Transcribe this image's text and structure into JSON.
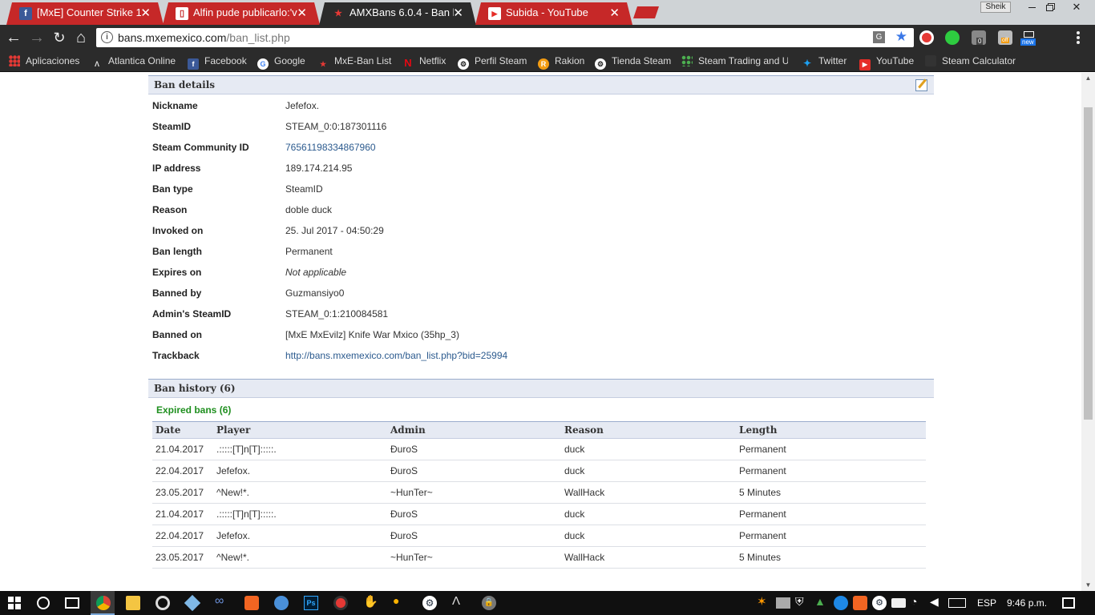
{
  "browser": {
    "tabs": [
      {
        "title": "[MxE] Counter Strike 1.6",
        "favicon": "facebook-icon",
        "active": false
      },
      {
        "title": "Alfin pude publicarlo:'v",
        "favicon": "document-icon",
        "active": false
      },
      {
        "title": "AMXBans 6.0.4 - Ban list",
        "favicon": "amxbans-icon",
        "active": true
      },
      {
        "title": "Subida - YouTube",
        "favicon": "youtube-icon",
        "active": false
      }
    ],
    "profile_name": "Sheik",
    "url_host": "bans.mxemexico.com",
    "url_path": "/ban_list.php",
    "ext_badge_count": "0",
    "ext_badge_off": "off",
    "ext_badge_new": "new",
    "bookmarks": [
      "Aplicaciones",
      "Atlantica Online",
      "Facebook",
      "Google",
      "MxE-Ban List",
      "Netflix",
      "Perfil Steam",
      "Rakion",
      "Tienda Steam",
      "Steam Trading and U",
      "Twitter",
      "YouTube",
      "Steam Calculator"
    ]
  },
  "ban_details": {
    "title": "Ban details",
    "rows": [
      {
        "label": "Nickname",
        "value": "Jefefox."
      },
      {
        "label": "SteamID",
        "value": "STEAM_0:0:187301116"
      },
      {
        "label": "Steam Community ID",
        "value": "76561198334867960"
      },
      {
        "label": "IP address",
        "value": "189.174.214.95"
      },
      {
        "label": "Ban type",
        "value": "SteamID"
      },
      {
        "label": "Reason",
        "value": "doble duck"
      },
      {
        "label": "Invoked on",
        "value": "25. Jul 2017 - 04:50:29"
      },
      {
        "label": "Ban length",
        "value": "Permanent"
      },
      {
        "label": "Expires on",
        "value": "Not applicable"
      },
      {
        "label": "Banned by",
        "value": "Guzmansiyo0"
      },
      {
        "label": "Admin's SteamID",
        "value": "STEAM_0:1:210084581"
      },
      {
        "label": "Banned on",
        "value": "[MxE MxEvilz] Knife War Mxico (35hp_3)"
      },
      {
        "label": "Trackback",
        "value": "http://bans.mxemexico.com/ban_list.php?bid=25994"
      }
    ]
  },
  "ban_history": {
    "title": "Ban history (6)",
    "expired_title": "Expired bans (6)",
    "columns": [
      "Date",
      "Player",
      "Admin",
      "Reason",
      "Length"
    ],
    "rows": [
      [
        "21.04.2017",
        ".:::::[T]n[T]:::::.",
        "ĐuroS",
        "duck",
        "Permanent"
      ],
      [
        "22.04.2017",
        "Jefefox.",
        "ĐuroS",
        "duck",
        "Permanent"
      ],
      [
        "23.05.2017",
        "^New!*.",
        "~HunTer~",
        "WallHack",
        "5 Minutes"
      ],
      [
        "21.04.2017",
        ".:::::[T]n[T]:::::.",
        "ĐuroS",
        "duck",
        "Permanent"
      ],
      [
        "22.04.2017",
        "Jefefox.",
        "ĐuroS",
        "duck",
        "Permanent"
      ],
      [
        "23.05.2017",
        "^New!*.",
        "~HunTer~",
        "WallHack",
        "5 Minutes"
      ]
    ]
  },
  "taskbar": {
    "language": "ESP",
    "time": "9:46 p.m."
  },
  "colors": {
    "tab_red": "#c62828",
    "chrome_dark": "#2b2b2b",
    "header_bg": "#e6eaf3",
    "link_blue": "#2b5a8e",
    "expired_green": "#1f8f1f"
  }
}
